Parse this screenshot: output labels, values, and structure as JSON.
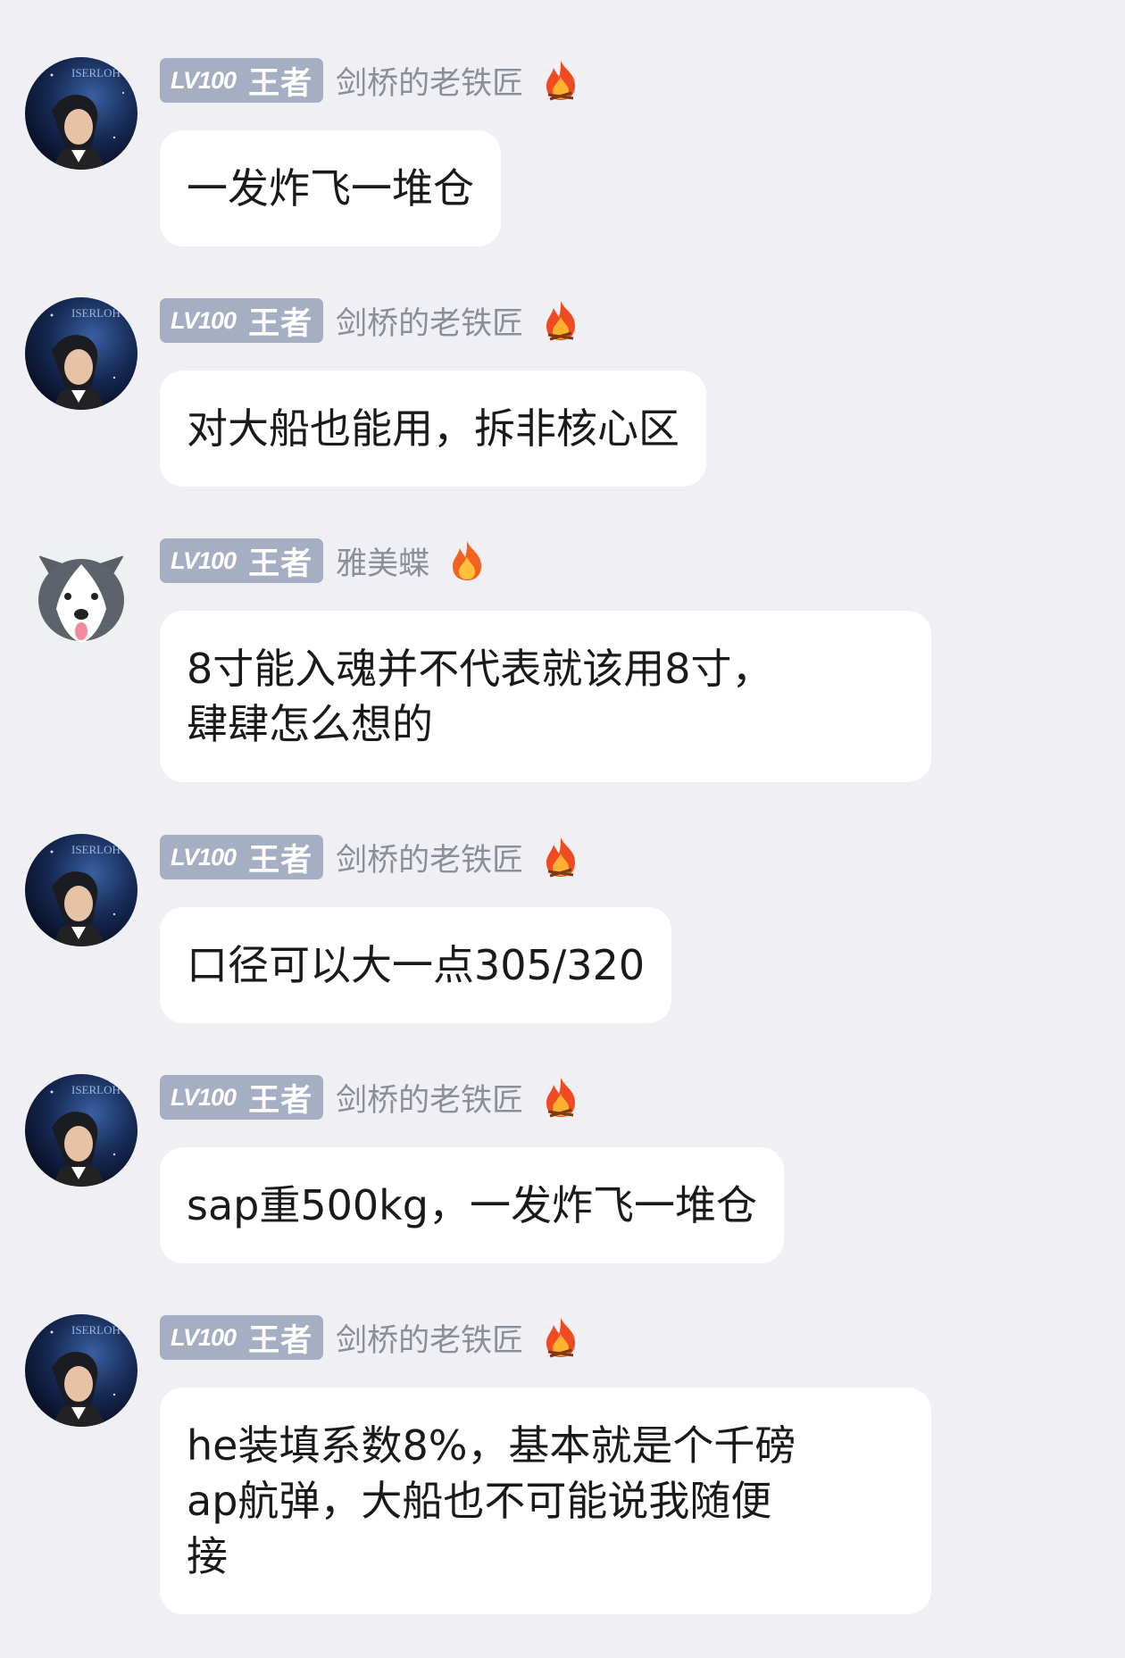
{
  "messages": [
    {
      "level": "LV100",
      "rank": "王者",
      "user": "剑桥的老铁匠",
      "avatar": "space-avatar",
      "lines": [
        "一发炸飞一堆仓"
      ]
    },
    {
      "level": "LV100",
      "rank": "王者",
      "user": "剑桥的老铁匠",
      "avatar": "space-avatar",
      "lines": [
        "对大船也能用，拆非核心区"
      ]
    },
    {
      "level": "LV100",
      "rank": "王者",
      "user": "雅美蝶",
      "avatar": "husky-avatar",
      "lines": [
        "8寸能入魂并不代表就该用8寸，",
        "肆肆怎么想的"
      ]
    },
    {
      "level": "LV100",
      "rank": "王者",
      "user": "剑桥的老铁匠",
      "avatar": "space-avatar",
      "lines": [
        "口径可以大一点305/320"
      ]
    },
    {
      "level": "LV100",
      "rank": "王者",
      "user": "剑桥的老铁匠",
      "avatar": "space-avatar",
      "lines": [
        "sap重500kg，一发炸飞一堆仓"
      ]
    },
    {
      "level": "LV100",
      "rank": "王者",
      "user": "剑桥的老铁匠",
      "avatar": "space-avatar",
      "lines": [
        "he装填系数8%，基本就是个千磅",
        "ap航弹，大船也不可能说我随便",
        "接"
      ]
    }
  ],
  "avatar_text": "ISERLOH",
  "icons": {
    "fire": "fire-icon"
  },
  "colors": {
    "background": "#efeff4",
    "badge": "#a6aec4",
    "bubble": "#ffffff",
    "username": "#8b8f98"
  }
}
